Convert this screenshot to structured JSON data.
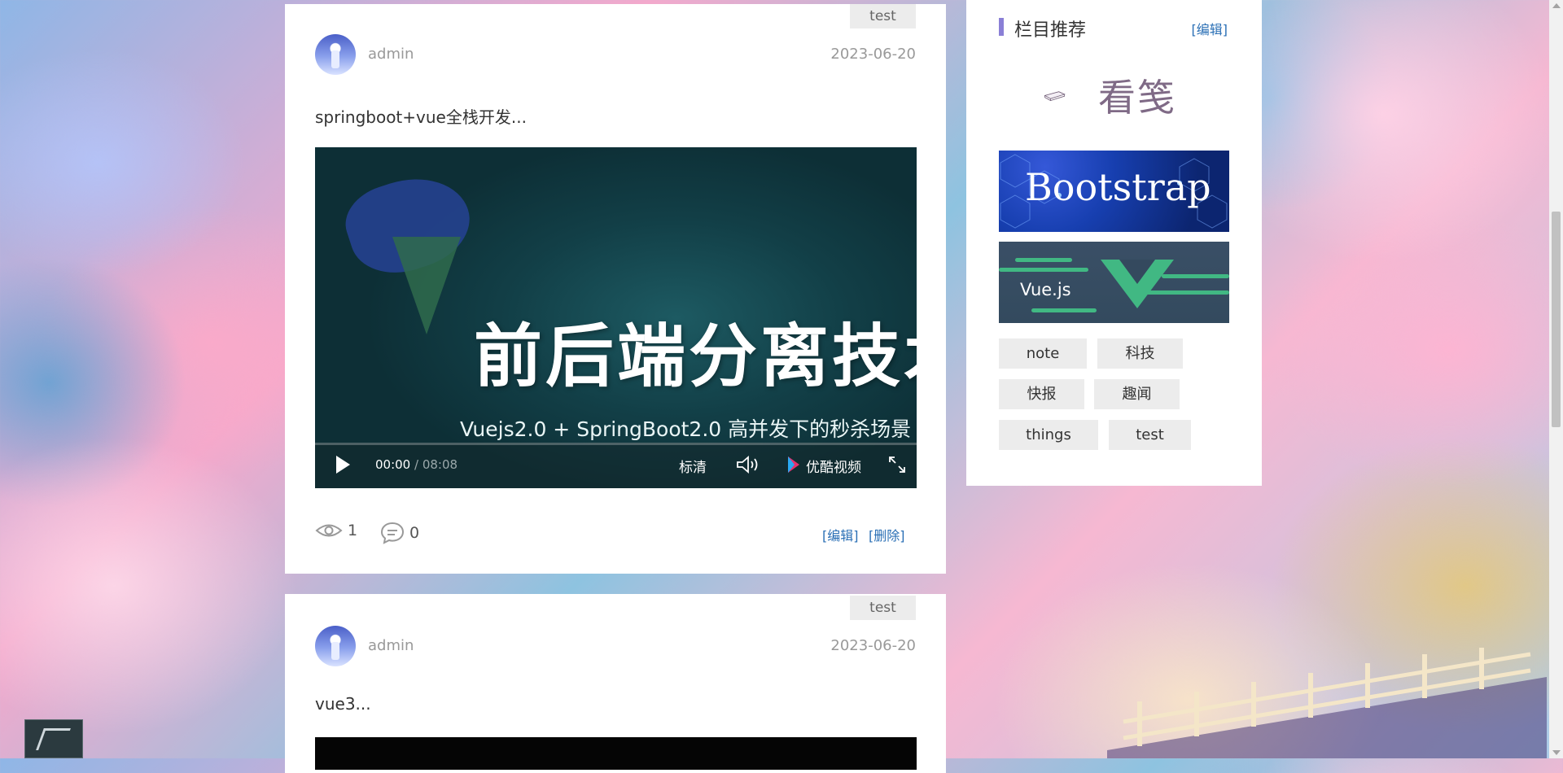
{
  "posts": [
    {
      "category": "test",
      "author": "admin",
      "date": "2023-06-20",
      "summary": "springboot+vue全栈开发...",
      "video": {
        "title": "前后端分离技术",
        "subtitle": "Vuejs2.0 + SpringBoot2.0 高并发下的秒杀场景",
        "current_time": "00:00",
        "total_time": "08:08",
        "quality": "标清",
        "provider": "优酷视频",
        "progress": 0
      },
      "views": "1",
      "comments": "0",
      "edit_label": "[编辑]",
      "delete_label": "[删除]"
    },
    {
      "category": "test",
      "author": "admin",
      "date": "2023-06-20",
      "summary": "vue3..."
    }
  ],
  "sidebar": {
    "title": "栏目推荐",
    "edit_label": "[编辑]",
    "brand": "看笺",
    "banners": [
      "Bootstrap",
      "Vue.js"
    ],
    "tags": [
      "note",
      "科技",
      "快报",
      "趣闻",
      "things",
      "test"
    ]
  },
  "colors": {
    "accent_bar": "#8a7fd6",
    "link": "#2a6fb5",
    "vue_green": "#41b883"
  }
}
